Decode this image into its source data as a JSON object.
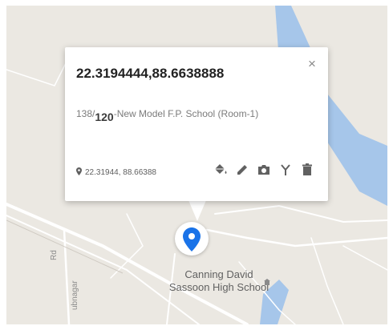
{
  "popup": {
    "title": "22.3194444,88.6638888",
    "description": {
      "prefix": "138/",
      "subscript": "120",
      "suffix": "-New Model F.P. School (Room-1)"
    },
    "coordinates": "22.31944, 88.66388",
    "close_glyph": "×",
    "tools": [
      "paint-bucket-icon",
      "pencil-icon",
      "camera-icon",
      "route-icon",
      "trash-icon"
    ]
  },
  "map": {
    "poi_label_line1": "Canning David",
    "poi_label_line2": "Sassoon High School",
    "road_label_1": "Rd",
    "road_label_2": "ubnagar",
    "marker_color": "#1a73e8",
    "water_color": "#a6c6ea",
    "land_color": "#ebe8e2"
  }
}
